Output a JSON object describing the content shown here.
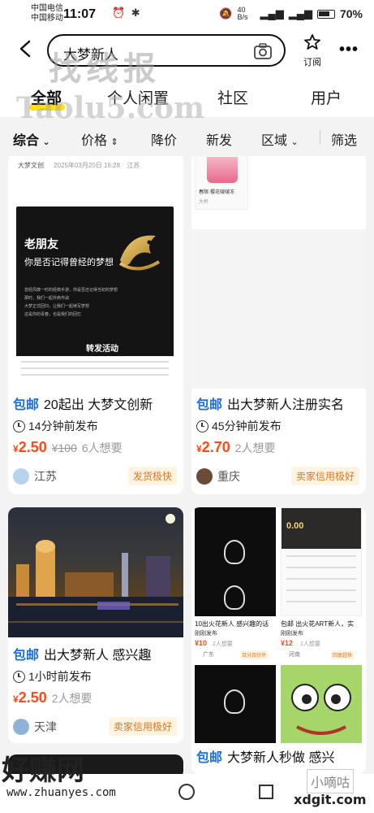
{
  "status_bar": {
    "carrier1": "中国电信",
    "carrier2": "中国移动",
    "time": "11:07",
    "net_speed": "40 B/s",
    "battery": "70%"
  },
  "search": {
    "query": "大梦新人",
    "subscribe_label": "订阅"
  },
  "tabs": [
    {
      "label": "全部",
      "active": true
    },
    {
      "label": "个人闲置",
      "active": false
    },
    {
      "label": "社区",
      "active": false
    },
    {
      "label": "用户",
      "active": false
    }
  ],
  "filters": [
    {
      "label": "综合",
      "active": true
    },
    {
      "label": "价格"
    },
    {
      "label": "降价"
    },
    {
      "label": "新发"
    },
    {
      "label": "区域"
    },
    {
      "label": "筛选"
    }
  ],
  "cards": [
    {
      "poster_top": "大梦文创",
      "poster_date": "2025年03月20日 16:28",
      "poster_loc": "江苏",
      "poster_line1": "老朋友",
      "poster_line2": "你是否记得曾经的梦想",
      "poster_body1": "曾经风靡一时的经典手游，你是否还记得当初的梦想",
      "poster_body2": "那时，我们一起并肩作战",
      "poster_body3": "大梦正式回归，让我们一起续写梦想",
      "poster_body4": "这是你的青春，也是我们的回忆",
      "poster_btn": "转发活动",
      "tag": "包邮",
      "title": "20起出  大梦文创新",
      "time": "14分钟前发布",
      "price_symbol": "¥",
      "price": "2.50",
      "orig": "¥100",
      "want": "6人想要",
      "seller": "江苏",
      "badge": "发货极快"
    },
    {
      "thumb_caption1": "春限·樱花啵啵冻",
      "thumb_caption2": "大杯",
      "tag": "包邮",
      "title": "出大梦新人注册实名",
      "time": "45分钟前发布",
      "price_symbol": "¥",
      "price": "2.70",
      "want": "2人想要",
      "seller": "重庆",
      "badge": "卖家信用极好"
    },
    {
      "tag": "包邮",
      "title": "出大梦新人 感兴趣",
      "time": "1小时前发布",
      "price_symbol": "¥",
      "price": "2.50",
      "want": "2人想要",
      "seller": "天津",
      "badge": "卖家信用极好"
    },
    {
      "sub_left_title": "10出火花新人 感兴趣的话",
      "sub_left_time": "刚刚发布",
      "sub_left_price": "¥10",
      "sub_left_want": "2人想要",
      "sub_left_loc": "广东",
      "sub_left_badge": "百分百好评",
      "sub_right_title": "包邮 出火花ART新人，实",
      "sub_right_time": "刚刚发布",
      "sub_right_price": "¥12",
      "sub_right_want": "1人想要",
      "sub_right_loc": "河南",
      "sub_right_badge": "回复超快",
      "sub_right_value": "0.00",
      "tag": "包邮",
      "title": "大梦新人秒做 感兴"
    }
  ],
  "watermarks": {
    "top": "找线报",
    "taolu": "Taolu5.com",
    "haozhuan": "好赚网",
    "url": "www.zhuanyes.com",
    "xiao": "小嘀咕",
    "xdg": "xdgit.com"
  }
}
